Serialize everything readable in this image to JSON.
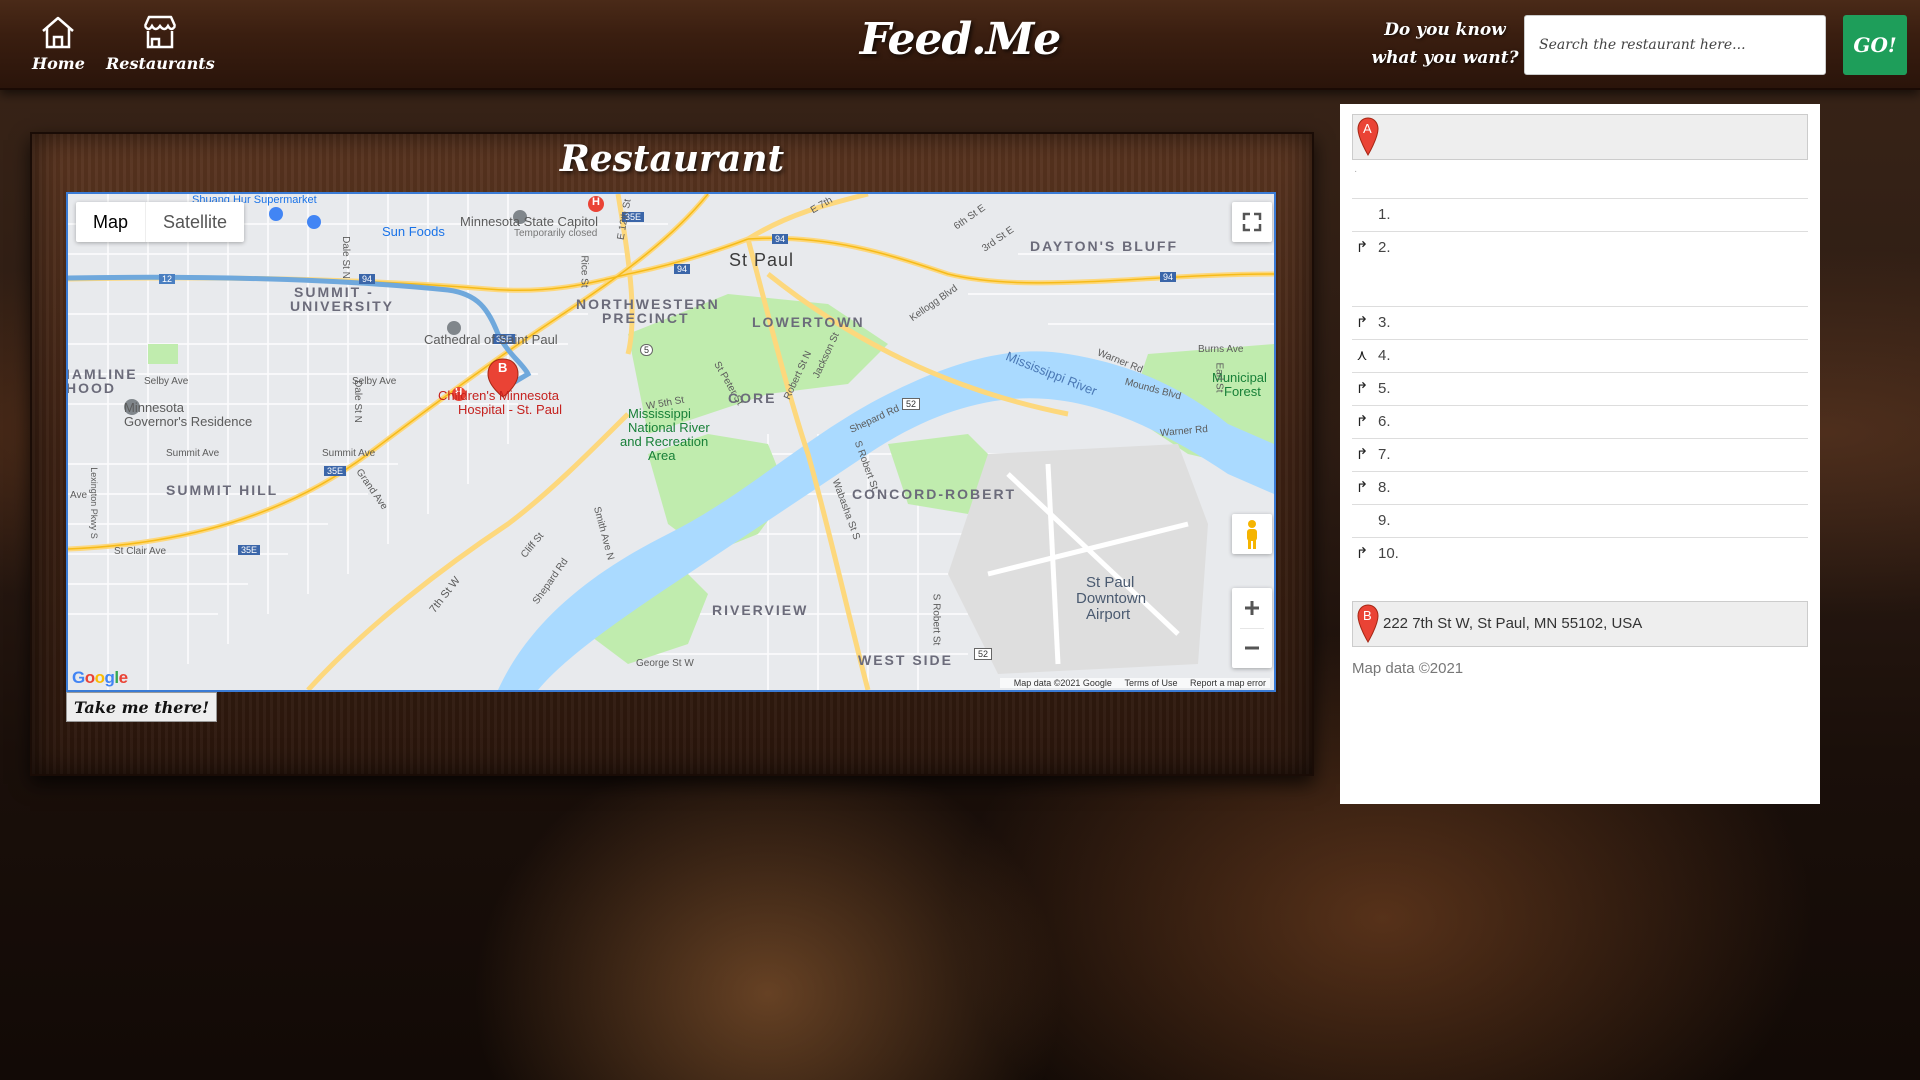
{
  "header": {
    "nav": [
      {
        "label": "Home",
        "icon": "home-icon"
      },
      {
        "label": "Restaurants",
        "icon": "storefront-icon"
      }
    ],
    "brand": "Feed.Me",
    "prompt_line1": "Do you know",
    "prompt_line2": "what you want?",
    "search_placeholder": "Search the restaurant here...",
    "go_label": "GO!"
  },
  "main": {
    "title": "Restaurant",
    "take_me_label": "Take me there!"
  },
  "map": {
    "type_options": [
      "Map",
      "Satellite"
    ],
    "selected_type": "Map",
    "labels": {
      "st_paul": "St Paul",
      "sun_foods": "Sun Foods",
      "capitol": "Minnesota State Capitol",
      "capitol_status": "Temporarily closed",
      "shuang": "Shuang Hur Supermarket",
      "cathedral": "Cathedral of Saint Paul",
      "childrens1": "Children's Minnesota",
      "childrens2": "Hospital - St. Paul",
      "governor1": "Minnesota",
      "governor2": "Governor's Residence",
      "mnrra1": "Mississippi",
      "mnrra2": "National River",
      "mnrra3": "and Recreation",
      "mnrra4": "Area",
      "mississippi": "Mississippi River",
      "airport1": "St Paul",
      "airport2": "Downtown",
      "airport3": "Airport",
      "municipal1": "Municipal",
      "municipal2": "Forest",
      "selby1": "Selby Ave",
      "selby2": "Selby Ave",
      "summit_ave1": "Summit Ave",
      "summit_ave2": "Summit Ave",
      "st_clair": "St Clair Ave",
      "george": "George St W",
      "w5th": "W 5th St",
      "seventh": "7th St W",
      "shepard1": "Shepard Rd",
      "shepard2": "Shepard Rd",
      "warner1": "Warner Rd",
      "warner2": "Warner Rd",
      "mounds": "Mounds Blvd",
      "burns": "Burns Ave",
      "kellogg": "Kellogg Blvd",
      "robert1": "Robert St N",
      "robert2": "S Robert St",
      "wabasha": "Wabasha St S",
      "dale1": "Dale St N",
      "dale2": "Dale St N",
      "grand": "Grand Ave",
      "smith": "Smith Ave N",
      "cliff": "Cliff St",
      "jackson": "Jackson St",
      "stpeter": "St Peter St",
      "rice": "Rice St",
      "earl": "Earl St",
      "e7th": "E 7th",
      "e6th": "6th St E",
      "e3rd": "3rd St E",
      "e12th": "E 12th St",
      "lexington": "Lexington Pkwy S",
      "ave": "Ave",
      "sroberts": "S Robert St"
    },
    "districts": {
      "summit_university1": "SUMMIT -",
      "summit_university2": "UNIVERSITY",
      "northwestern1": "NORTHWESTERN",
      "northwestern2": "PRECINCT",
      "lowertown": "LOWERTOWN",
      "core": "CORE",
      "daytons": "DAYTON'S BLUFF",
      "hamline1": "IAMLINE",
      "hamline2": "HOOD",
      "summit_hill": "SUMMIT HILL",
      "concord": "CONCORD-ROBERT",
      "riverview": "RIVERVIEW",
      "west_side": "WEST SIDE"
    },
    "shields": {
      "i94a": "94",
      "i94b": "94",
      "i94c": "94",
      "i35e_a": "35E",
      "i35e_b": "35E",
      "i35e_c": "35E",
      "i35e_d": "35E",
      "us52a": "52",
      "us52b": "52",
      "us12": "12",
      "r5": "5"
    },
    "marker_b": "B",
    "hospital_marker": "H",
    "google": "Google",
    "attribution": [
      "Map data ©2021 Google",
      "Terms of Use",
      "Report a map error"
    ],
    "colors": {
      "water": "#aadaff",
      "park": "#c0ecae",
      "road_major": "#fdd87d",
      "route": "#6fa8dc"
    }
  },
  "directions": {
    "origin_marker": "A",
    "origin_address": "",
    "destination_marker": "B",
    "destination_address": "222 7th St W, St Paul, MN 55102, USA",
    "dot": "·",
    "steps": [
      {
        "num": "1.",
        "maneuver": ""
      },
      {
        "num": "2.",
        "maneuver": "↱"
      },
      {
        "num": "3.",
        "maneuver": "↱"
      },
      {
        "num": "4.",
        "maneuver": "⋏"
      },
      {
        "num": "5.",
        "maneuver": "↱"
      },
      {
        "num": "6.",
        "maneuver": "↱"
      },
      {
        "num": "7.",
        "maneuver": "↱"
      },
      {
        "num": "8.",
        "maneuver": "↱"
      },
      {
        "num": "9.",
        "maneuver": ""
      },
      {
        "num": "10.",
        "maneuver": "↱"
      }
    ],
    "copyright": "Map data ©2021"
  }
}
